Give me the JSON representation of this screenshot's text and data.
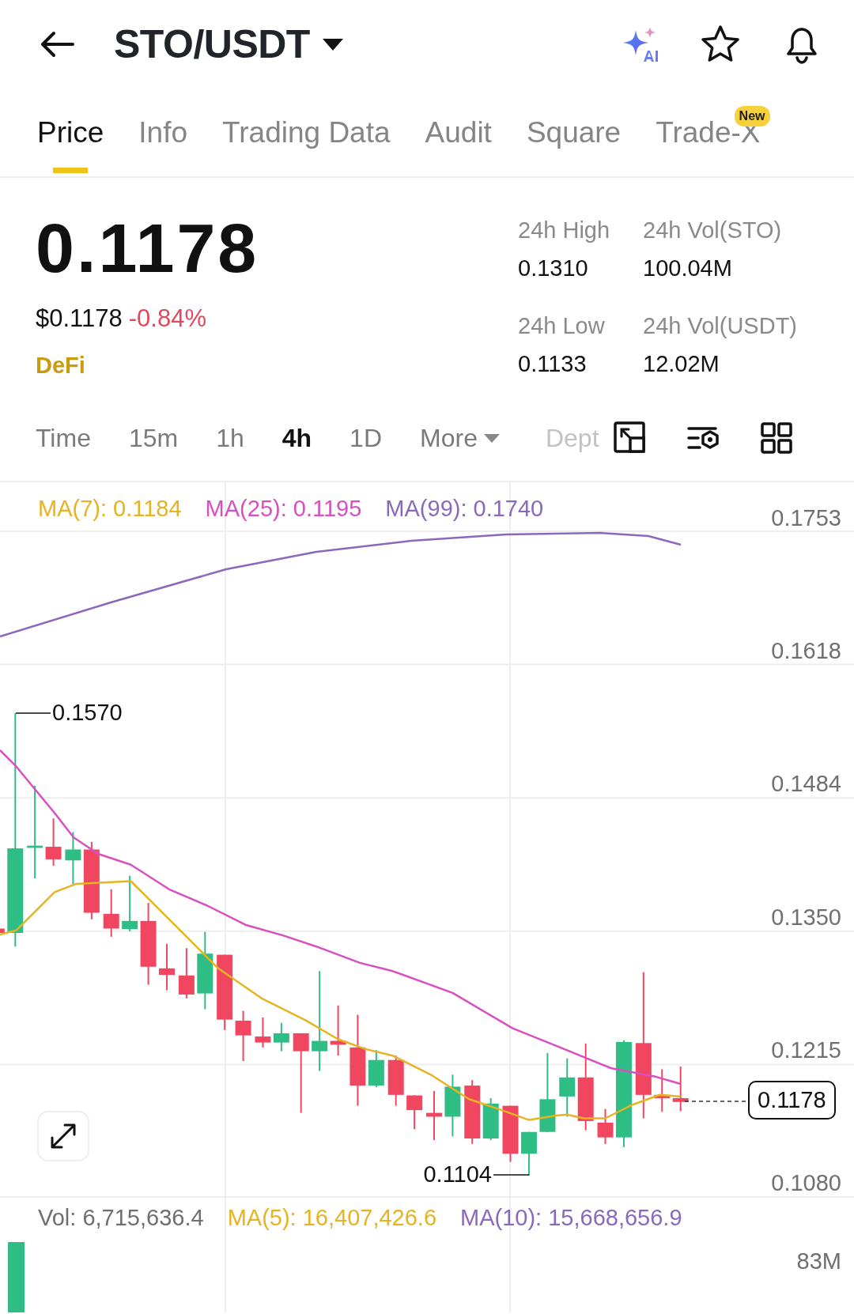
{
  "header": {
    "pair": "STO/USDT"
  },
  "tabs": [
    {
      "label": "Price",
      "selected": true
    },
    {
      "label": "Info",
      "selected": false
    },
    {
      "label": "Trading Data",
      "selected": false
    },
    {
      "label": "Audit",
      "selected": false
    },
    {
      "label": "Square",
      "selected": false
    },
    {
      "label": "Trade-X",
      "selected": false,
      "badge": "New"
    }
  ],
  "price": {
    "last": "0.1178",
    "usd": "$0.1178",
    "change": "-0.84%",
    "tag": "DeFi"
  },
  "stats": [
    {
      "label": "24h High",
      "value": "0.1310"
    },
    {
      "label": "24h Vol(STO)",
      "value": "100.04M"
    },
    {
      "label": "24h Low",
      "value": "0.1133"
    },
    {
      "label": "24h Vol(USDT)",
      "value": "12.02M"
    }
  ],
  "intervals": [
    {
      "label": "Time",
      "selected": false,
      "kind": "option"
    },
    {
      "label": "15m",
      "selected": false,
      "kind": "option"
    },
    {
      "label": "1h",
      "selected": false,
      "kind": "option"
    },
    {
      "label": "4h",
      "selected": true,
      "kind": "option"
    },
    {
      "label": "1D",
      "selected": false,
      "kind": "option"
    },
    {
      "label": "More",
      "selected": false,
      "kind": "dropdown"
    },
    {
      "label": "Dept",
      "selected": false,
      "kind": "cut"
    }
  ],
  "chart": {
    "ma_legend": [
      {
        "label": "MA(7): 0.1184",
        "color": "#e6b422"
      },
      {
        "label": "MA(25): 0.1195",
        "color": "#d84fbf"
      },
      {
        "label": "MA(99): 0.1740",
        "color": "#8a68bc"
      }
    ],
    "y_axis": [
      "0.1753",
      "0.1618",
      "0.1484",
      "0.1350",
      "0.1215",
      "0.1080"
    ],
    "high_label": "0.1570",
    "low_label": "0.1104",
    "last_price": "0.1178"
  },
  "volume": {
    "legend": [
      {
        "label": "Vol: 6,715,636.4",
        "color": "#6f6f6f"
      },
      {
        "label": "MA(5): 16,407,426.6",
        "color": "#e6b422"
      },
      {
        "label": "MA(10): 15,668,656.9",
        "color": "#8a68bc"
      }
    ],
    "y_axis": [
      "83M"
    ]
  }
}
